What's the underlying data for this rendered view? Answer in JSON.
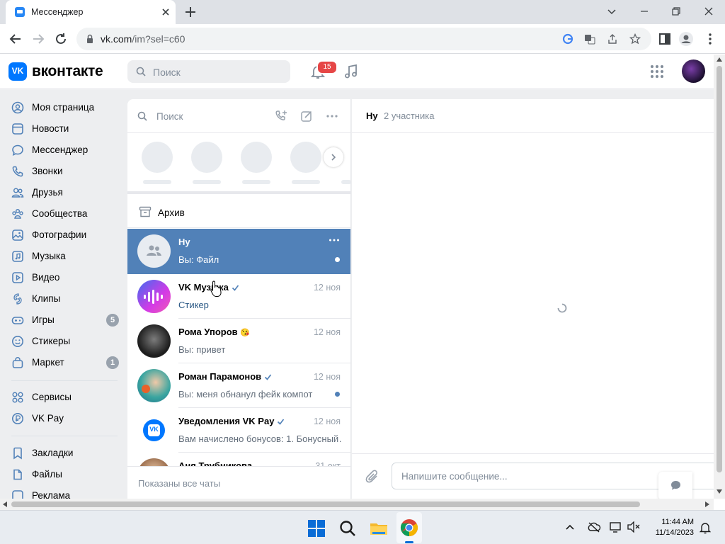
{
  "browser": {
    "tab_title": "Мессенджер",
    "url_host": "vk.com",
    "url_path": "/im?sel=c60"
  },
  "header": {
    "logo_text": "вконтакте",
    "search_placeholder": "Поиск",
    "notifications_count": "15"
  },
  "sidebar": {
    "items": [
      {
        "label": "Моя страница",
        "icon": "user-circle-icon"
      },
      {
        "label": "Новости",
        "icon": "news-icon"
      },
      {
        "label": "Мессенджер",
        "icon": "message-icon"
      },
      {
        "label": "Звонки",
        "icon": "phone-icon"
      },
      {
        "label": "Друзья",
        "icon": "friends-icon"
      },
      {
        "label": "Сообщества",
        "icon": "communities-icon"
      },
      {
        "label": "Фотографии",
        "icon": "photo-icon"
      },
      {
        "label": "Музыка",
        "icon": "music-icon"
      },
      {
        "label": "Видео",
        "icon": "video-icon"
      },
      {
        "label": "Клипы",
        "icon": "clips-icon"
      },
      {
        "label": "Игры",
        "icon": "gamepad-icon",
        "count": "5"
      },
      {
        "label": "Стикеры",
        "icon": "smile-icon"
      },
      {
        "label": "Маркет",
        "icon": "bag-icon",
        "count": "1"
      }
    ],
    "items2": [
      {
        "label": "Сервисы",
        "icon": "services-icon"
      },
      {
        "label": "VK Pay",
        "icon": "vkpay-icon"
      }
    ],
    "items3": [
      {
        "label": "Закладки",
        "icon": "bookmark-icon"
      },
      {
        "label": "Файлы",
        "icon": "file-icon"
      },
      {
        "label": "Реклама",
        "icon": "ads-icon"
      }
    ]
  },
  "chatlist": {
    "search_placeholder": "Поиск",
    "archive_label": "Архив",
    "footer": "Показаны все чаты",
    "conversations": [
      {
        "name": "Ну",
        "date": "",
        "preview": "Вы: Файл",
        "active": true
      },
      {
        "name": "VK Музыка",
        "date": "12 ноя",
        "preview": "Стикер",
        "verified": true
      },
      {
        "name": "Рома Упоров",
        "emoji": "😘",
        "date": "12 ноя",
        "preview": "Вы: привет"
      },
      {
        "name": "Роман Парамонов",
        "date": "12 ноя",
        "preview": "Вы: меня обнанул фейк компот",
        "verified": true,
        "unread": true
      },
      {
        "name": "Уведомления VK Pay",
        "date": "12 ноя",
        "preview": "Вам начислено бонусов: 1. Бонусный…",
        "verified": true
      },
      {
        "name": "Аня Трубникова",
        "date": "31 окт",
        "preview": ""
      }
    ]
  },
  "chat": {
    "title": "Ну",
    "subtitle": "2 участника",
    "input_placeholder": "Напишите сообщение..."
  },
  "taskbar": {
    "time": "11:44 AM",
    "date": "11/14/2023"
  },
  "colors": {
    "vk_blue": "#0077ff",
    "active_row": "#5181b8",
    "badge_red": "#e64646"
  }
}
